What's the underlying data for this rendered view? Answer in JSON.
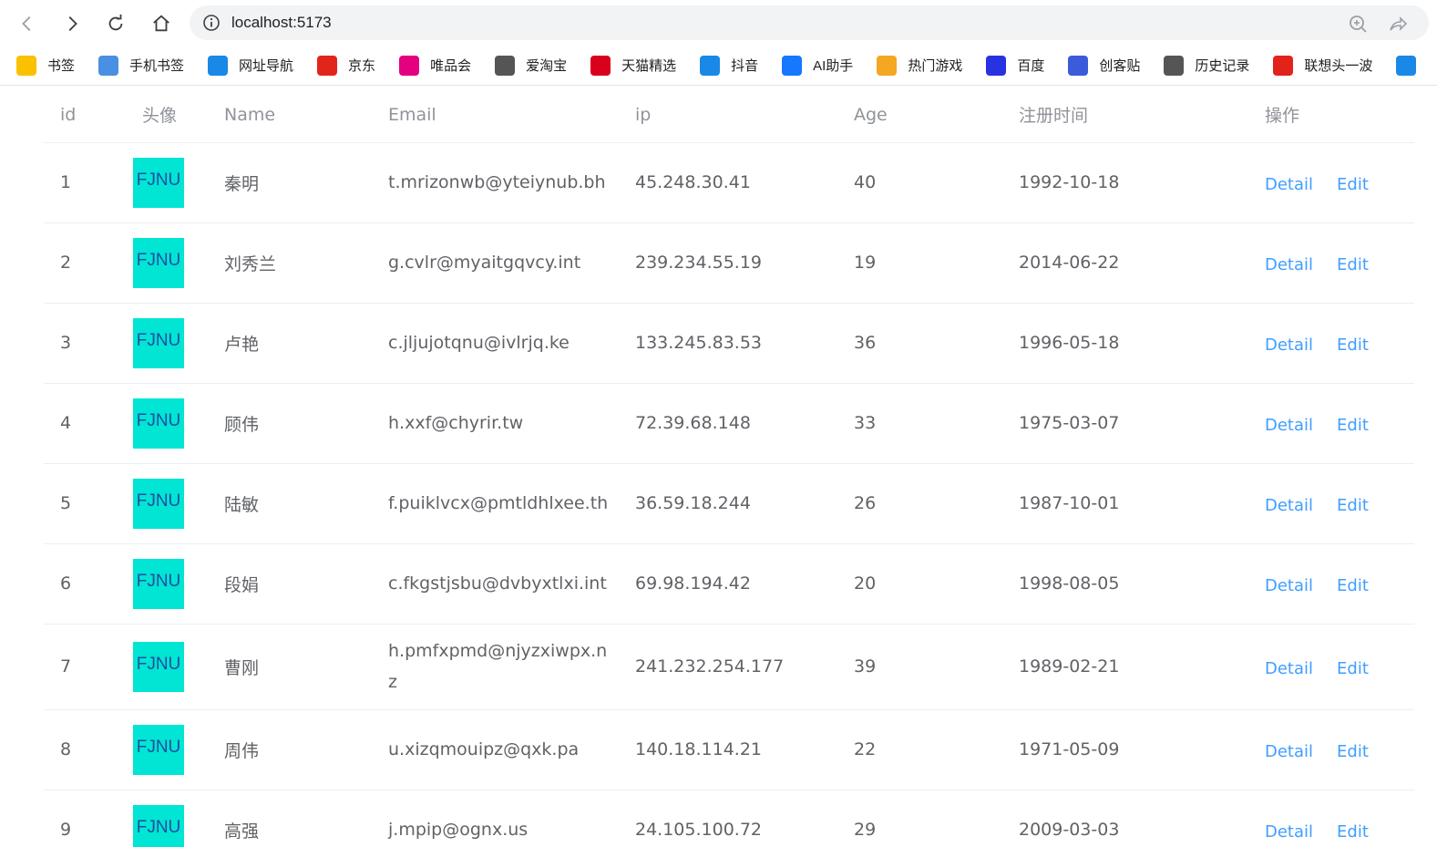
{
  "browser": {
    "url": "localhost:5173",
    "bookmarks": [
      {
        "label": "书签",
        "icon": "star-icon",
        "color": "#f9c100"
      },
      {
        "label": "手机书签",
        "icon": "phone-bookmark-icon",
        "color": "#4a90e2"
      },
      {
        "label": "网址导航",
        "icon": "e-browser-icon",
        "color": "#1a88e6"
      },
      {
        "label": "京东",
        "icon": "jd-icon",
        "color": "#e1251b"
      },
      {
        "label": "唯品会",
        "icon": "vip-icon",
        "color": "#e4007f"
      },
      {
        "label": "爱淘宝",
        "icon": "taobao-icon",
        "color": "#555555"
      },
      {
        "label": "天猫精选",
        "icon": "tmall-icon",
        "color": "#d9001b"
      },
      {
        "label": "抖音",
        "icon": "douyin-icon",
        "color": "#1a88e6"
      },
      {
        "label": "AI助手",
        "icon": "ai-assistant-icon",
        "color": "#1677ff"
      },
      {
        "label": "热门游戏",
        "icon": "game-icon",
        "color": "#f5a623"
      },
      {
        "label": "百度",
        "icon": "baidu-icon",
        "color": "#2932e1"
      },
      {
        "label": "创客贴",
        "icon": "chuangketie-icon",
        "color": "#3b5bdb"
      },
      {
        "label": "历史记录",
        "icon": "history-icon",
        "color": "#555555"
      },
      {
        "label": "联想头一波",
        "icon": "lenovo-icon",
        "color": "#e2231a"
      },
      {
        "label": "",
        "icon": "e-browser-icon",
        "color": "#1a88e6"
      }
    ]
  },
  "table": {
    "headers": {
      "id": "id",
      "avatar": "头像",
      "name": "Name",
      "email": "Email",
      "ip": "ip",
      "age": "Age",
      "registered": "注册时间",
      "actions": "操作"
    },
    "avatar_text": "FJNU",
    "detail_label": "Detail",
    "edit_label": "Edit",
    "rows": [
      {
        "id": "1",
        "name": "秦明",
        "email": "t.mrizonwb@yteiynub.bh",
        "ip": "45.248.30.41",
        "age": "40",
        "date": "1992-10-18"
      },
      {
        "id": "2",
        "name": "刘秀兰",
        "email": "g.cvlr@myaitgqvcy.int",
        "ip": "239.234.55.19",
        "age": "19",
        "date": "2014-06-22"
      },
      {
        "id": "3",
        "name": "卢艳",
        "email": "c.jljujotqnu@ivlrjq.ke",
        "ip": "133.245.83.53",
        "age": "36",
        "date": "1996-05-18"
      },
      {
        "id": "4",
        "name": "顾伟",
        "email": "h.xxf@chyrir.tw",
        "ip": "72.39.68.148",
        "age": "33",
        "date": "1975-03-07"
      },
      {
        "id": "5",
        "name": "陆敏",
        "email": "f.puiklvcx@pmtldhlxee.th",
        "ip": "36.59.18.244",
        "age": "26",
        "date": "1987-10-01"
      },
      {
        "id": "6",
        "name": "段娟",
        "email": "c.fkgstjsbu@dvbyxtlxi.int",
        "ip": "69.98.194.42",
        "age": "20",
        "date": "1998-08-05"
      },
      {
        "id": "7",
        "name": "曹刚",
        "email": "h.pmfxpmd@njyzxiwpx.nz",
        "ip": "241.232.254.177",
        "age": "39",
        "date": "1989-02-21"
      },
      {
        "id": "8",
        "name": "周伟",
        "email": "u.xizqmouipz@qxk.pa",
        "ip": "140.18.114.21",
        "age": "22",
        "date": "1971-05-09"
      },
      {
        "id": "9",
        "name": "高强",
        "email": "j.mpip@ognx.us",
        "ip": "24.105.100.72",
        "age": "29",
        "date": "2009-03-03"
      }
    ]
  }
}
